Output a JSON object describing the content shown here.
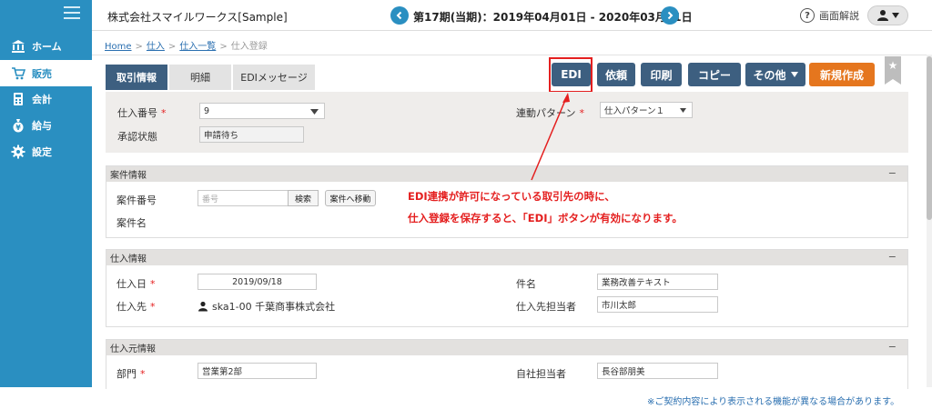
{
  "sidebar": {
    "items": [
      {
        "label": "ホーム",
        "icon": "bank-icon"
      },
      {
        "label": "販売",
        "icon": "cart-icon"
      },
      {
        "label": "会計",
        "icon": "calculator-icon"
      },
      {
        "label": "給与",
        "icon": "money-bag-icon"
      },
      {
        "label": "設定",
        "icon": "gear-icon"
      }
    ],
    "active_index": 1
  },
  "header": {
    "company": "株式会社スマイルワークス[Sample]",
    "period": "第17期(当期)：2019年04月01日 - 2020年03月31日",
    "help_label": "画面解説"
  },
  "breadcrumb": [
    "Home",
    "仕入",
    "仕入一覧",
    "仕入登録"
  ],
  "tabs": [
    {
      "label": "取引情報",
      "active": true
    },
    {
      "label": "明細",
      "active": false
    },
    {
      "label": "EDIメッセージ",
      "active": false
    }
  ],
  "toolbar": {
    "edi": "EDI",
    "request": "依頼",
    "print": "印刷",
    "copy": "コピー",
    "other": "その他",
    "new": "新規作成"
  },
  "header_section": {
    "purchase_no_label": "仕入番号",
    "purchase_no_value": "9",
    "approval_label": "承認状態",
    "approval_value": "申請待ち",
    "link_pattern_label": "連動パターン",
    "link_pattern_value": "仕入パターン１"
  },
  "case_section": {
    "title": "案件情報",
    "case_no_label": "案件番号",
    "case_no_placeholder": "番号",
    "search_button": "検索",
    "move_button": "案件へ移動",
    "case_name_label": "案件名"
  },
  "purchase_section": {
    "title": "仕入情報",
    "date_label": "仕入日",
    "date_value": "2019/09/18",
    "supplier_label": "仕入先",
    "supplier_value": "ska1-00  千葉商事株式会社",
    "subject_label": "件名",
    "subject_value": "業務改善テキスト",
    "supplier_contact_label": "仕入先担当者",
    "supplier_contact_value": "市川太郎"
  },
  "origin_section": {
    "title": "仕入元情報",
    "dept_label": "部門",
    "dept_value": "営業第2部",
    "staff_label": "自社担当者",
    "staff_value": "長谷部朋美"
  },
  "annotation": {
    "line1": "EDI連携が許可になっている取引先の時に、",
    "line2": "仕入登録を保存すると、「EDI」ボタンが有効になります。"
  },
  "footer_note": "※ご契約内容により表示される機能が異なる場合があります。",
  "colors": {
    "sidebar": "#2a8fc1",
    "button_dark": "#3d5f80",
    "button_orange": "#e5761e",
    "annotation_red": "#e41f1f"
  }
}
